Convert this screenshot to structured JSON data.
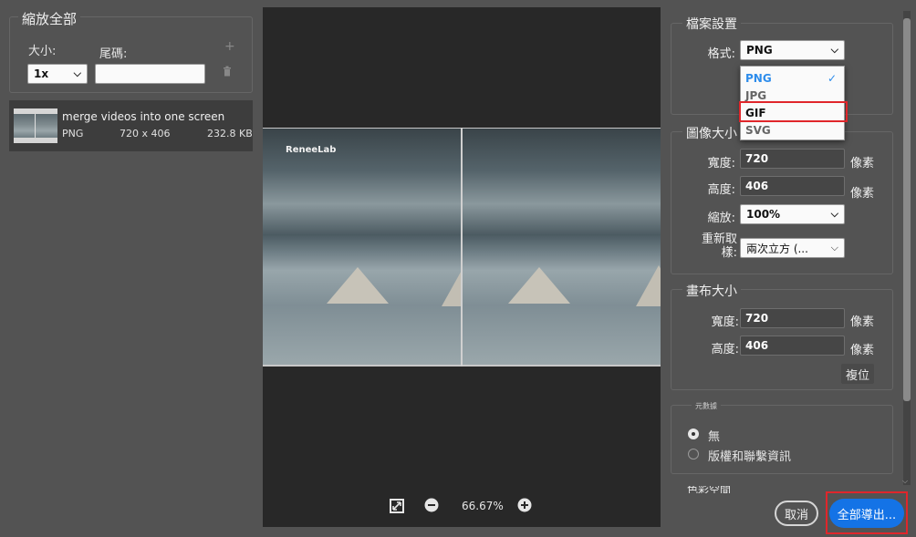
{
  "left_panel": {
    "scale_all_title": "縮放全部",
    "size_label": "大小:",
    "suffix_label": "尾碼:",
    "size_value": "1x",
    "suffix_value": "",
    "add_icon": "+",
    "delete_icon": "trash",
    "asset": {
      "name": "merge videos into one screen",
      "format": "PNG",
      "dimensions": "720 x 406",
      "file_size": "232.8 KB"
    }
  },
  "preview": {
    "watermark": "ReneeLab",
    "zoom_level": "66.67%"
  },
  "file_settings": {
    "title": "檔案設置",
    "format_label": "格式:",
    "format_value": "PNG",
    "format_options": [
      "PNG",
      "JPG",
      "GIF",
      "SVG"
    ],
    "selected_option": "PNG",
    "highlighted_option": "GIF"
  },
  "image_size": {
    "title": "圖像大小",
    "width_label": "寬度:",
    "width_value": "720",
    "height_label": "高度:",
    "height_value": "406",
    "unit": "像素",
    "scale_label": "縮放:",
    "scale_value": "100%",
    "resample_label_line1": "重新取",
    "resample_label_line2": "樣:",
    "resample_value": "兩次立方 (..."
  },
  "canvas_size": {
    "title": "畫布大小",
    "width_label": "寬度:",
    "width_value": "720",
    "height_label": "高度:",
    "height_value": "406",
    "unit": "像素",
    "reset_label": "複位"
  },
  "metadata": {
    "title": "元數據",
    "option_none": "無",
    "option_copyright": "版權和聯繫資訊",
    "selected": "無",
    "next_section_partial": "色彩空間"
  },
  "footer": {
    "cancel_label": "取消",
    "export_all_label": "全部導出..."
  },
  "colors": {
    "accent": "#1473e6",
    "highlight": "#e0262b",
    "selected_option": "#2d8ceb"
  }
}
